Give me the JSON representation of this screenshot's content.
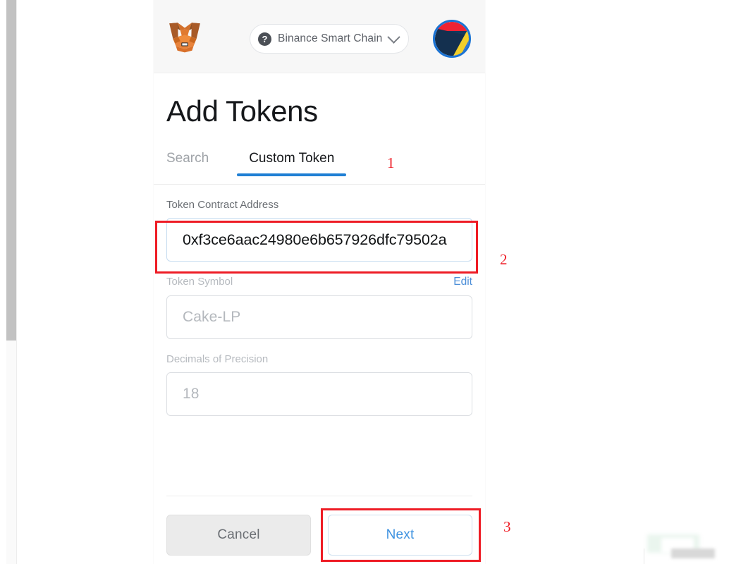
{
  "window": {
    "background_color": "#ffffff",
    "scrollbar": {
      "name": "vertical-scrollbar",
      "thumb_color": "#c2c2c2",
      "track_color": "#fafafa"
    }
  },
  "header": {
    "logo_icon": "metamask-fox-icon",
    "network": {
      "badge_icon": "question-mark-icon",
      "label": "Binance Smart Chain",
      "chevron_icon": "chevron-down-icon"
    },
    "avatar_icon": "account-identicon-avatar"
  },
  "page": {
    "title": "Add Tokens"
  },
  "tabs": [
    {
      "label": "Search",
      "active": false,
      "name": "tab-search"
    },
    {
      "label": "Custom Token",
      "active": true,
      "name": "tab-custom-token"
    }
  ],
  "form": {
    "contract_address": {
      "label": "Token Contract Address",
      "value": "0xf3ce6aac24980e6b657926dfc79502a",
      "focused": true
    },
    "token_symbol": {
      "label": "Token Symbol",
      "edit_label": "Edit",
      "value": "Cake-LP",
      "disabled": true
    },
    "decimals": {
      "label": "Decimals of Precision",
      "value": "18",
      "disabled": true
    }
  },
  "footer": {
    "cancel_label": "Cancel",
    "next_label": "Next"
  },
  "annotations": [
    {
      "number": "1",
      "target": "tab-custom-token"
    },
    {
      "number": "2",
      "target": "contract-address-input"
    },
    {
      "number": "3",
      "target": "next-button"
    }
  ],
  "colors": {
    "accent_blue": "#1f7fd4",
    "link_blue": "#4b8ed8",
    "annotation_red": "#ee1c25",
    "header_bg": "#f7f7f7",
    "muted_text": "#9fa3a8"
  }
}
